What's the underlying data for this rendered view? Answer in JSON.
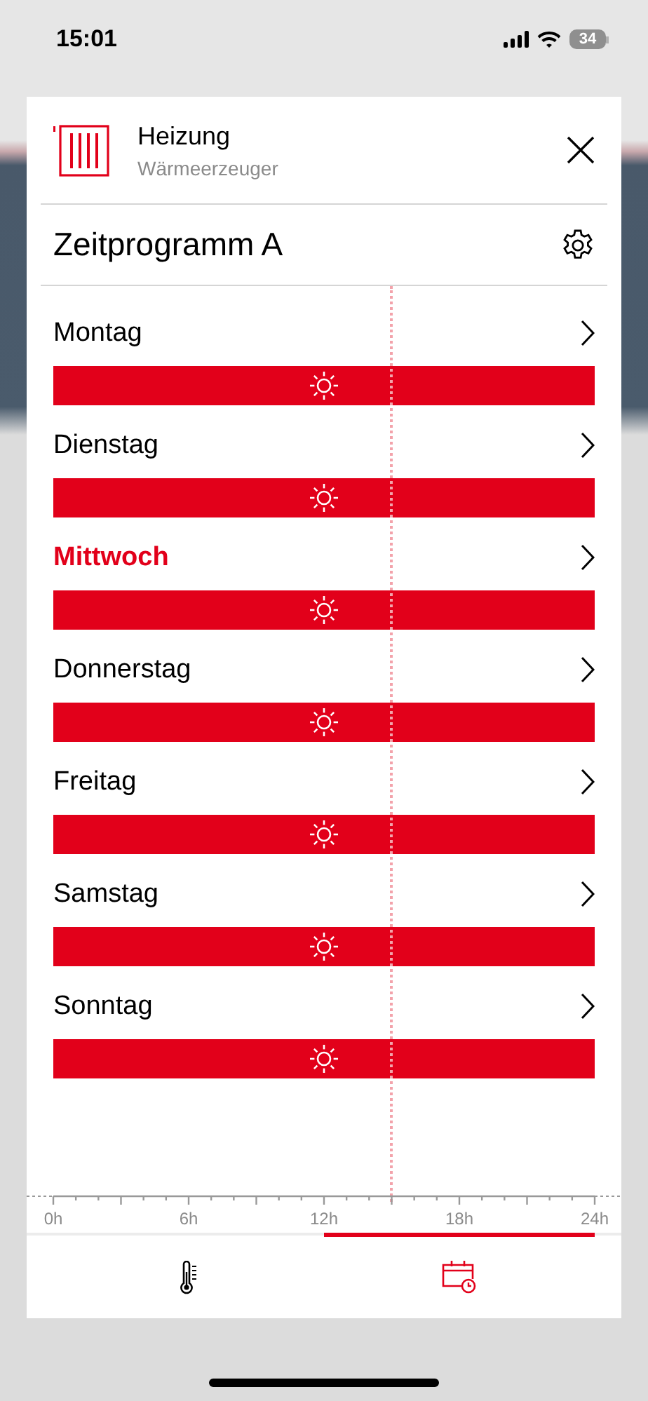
{
  "status_bar": {
    "time": "15:01",
    "battery": "34"
  },
  "header": {
    "title": "Heizung",
    "subtitle": "Wärmeerzeuger"
  },
  "program": {
    "title": "Zeitprogramm A"
  },
  "days": [
    {
      "label": "Montag",
      "today": false
    },
    {
      "label": "Dienstag",
      "today": false
    },
    {
      "label": "Mittwoch",
      "today": true
    },
    {
      "label": "Donnerstag",
      "today": false
    },
    {
      "label": "Freitag",
      "today": false
    },
    {
      "label": "Samstag",
      "today": false
    },
    {
      "label": "Sonntag",
      "today": false
    }
  ],
  "axis": {
    "labels": [
      "0h",
      "6h",
      "12h",
      "18h",
      "24h"
    ]
  },
  "tabs": [
    {
      "kind": "thermometer",
      "selected": false
    },
    {
      "kind": "calendar",
      "selected": true
    }
  ]
}
